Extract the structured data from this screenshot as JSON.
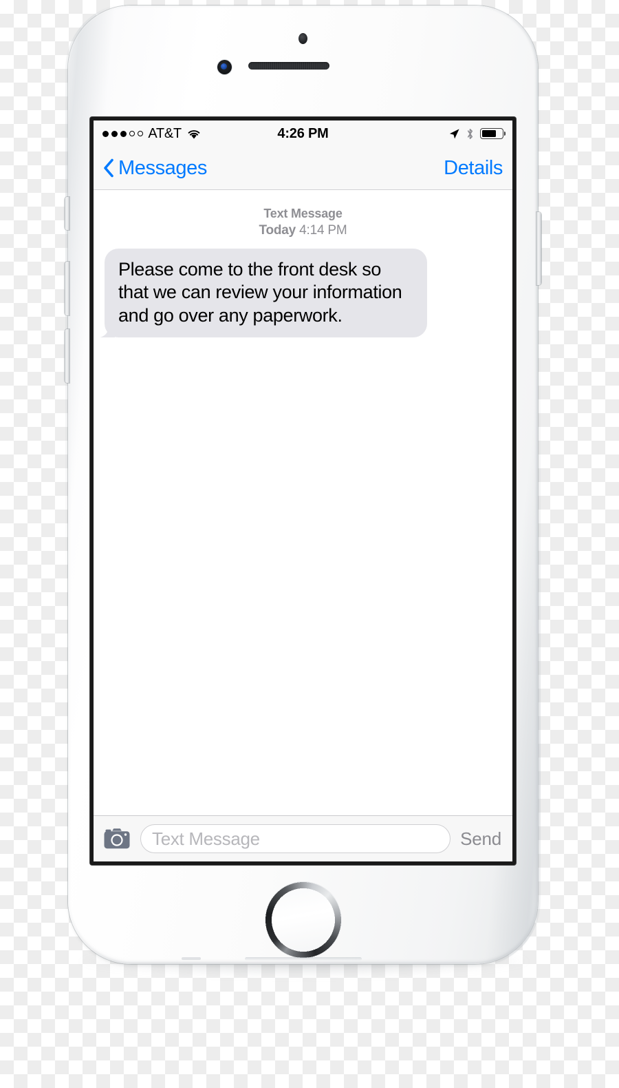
{
  "device": {
    "name": "iphone-6-silver",
    "hardware": {
      "sensor": "proximity-sensor",
      "camera": "front-camera",
      "speaker": "earpiece-speaker",
      "home_button": "home-button",
      "mute_switch": "mute-switch",
      "volume_up": "volume-up-button",
      "volume_down": "volume-down-button",
      "power": "power-button"
    }
  },
  "status_bar": {
    "signal_dots_filled": 3,
    "signal_dots_total": 5,
    "carrier": "AT&T",
    "wifi": "wifi-icon",
    "time": "4:26 PM",
    "location_icon": "location-arrow-icon",
    "bluetooth_icon": "bluetooth-icon",
    "battery_percent": 70,
    "battery_icon": "battery-icon"
  },
  "nav_bar": {
    "back_icon": "chevron-left-icon",
    "back_label": "Messages",
    "details_label": "Details"
  },
  "conversation": {
    "meta_type": "Text Message",
    "meta_day": "Today",
    "meta_time": "4:14 PM",
    "messages": [
      {
        "id": "msg-1",
        "direction": "incoming",
        "text": "Please come to the front desk so that we can review your information and go over any paperwork."
      }
    ]
  },
  "input_bar": {
    "camera_icon": "camera-icon",
    "placeholder": "Text Message",
    "value": "",
    "send_label": "Send"
  },
  "colors": {
    "accent_blue": "#007aff",
    "bubble_incoming": "#e5e5ea",
    "meta_gray": "#8e8e93",
    "send_disabled": "#8b8b90",
    "camera_gray": "#6d7584",
    "bar_background": "#f8f8f8"
  }
}
